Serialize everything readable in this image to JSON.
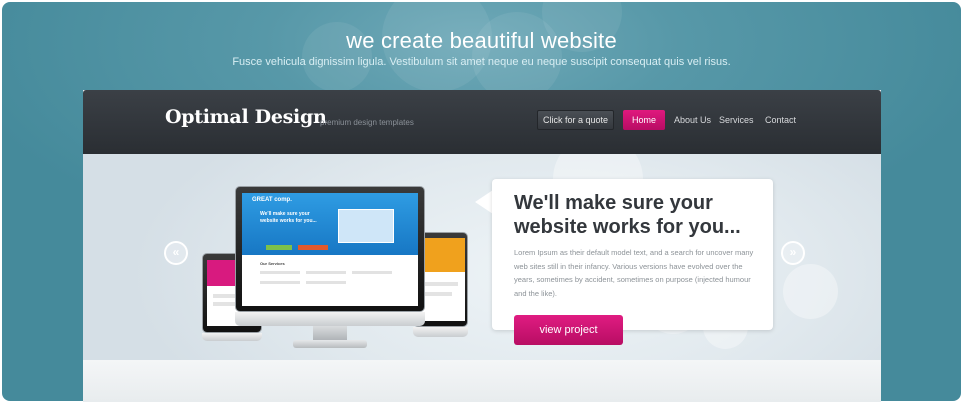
{
  "hero": {
    "headline": "we create beautiful website",
    "subline": "Fusce vehicula dignissim ligula. Vestibulum sit amet neque eu neque suscipit consequat quis vel risus."
  },
  "site": {
    "logo": "Optimal Design",
    "tagline": "premium design templates",
    "quote_button": "Click for a quote",
    "nav": [
      "Home",
      "About Us",
      "Services",
      "Contact"
    ],
    "active_nav": "Home"
  },
  "slide": {
    "title": "We'll make sure your website works for you...",
    "body": "Lorem Ipsum as their default model text, and a search for uncover many web sites still in their infancy. Various versions have evolved over the years, sometimes by accident, sometimes on purpose (injected humour and the like).",
    "button": "view project",
    "prev_icon": "double-chevron-left-icon",
    "next_icon": "double-chevron-right-icon"
  },
  "screen_mockup": {
    "brand": "GREAT comp.",
    "headline": "We'll make sure your website works for you...",
    "section": "Our Services"
  },
  "colors": {
    "accent": "#d4127a",
    "teal_background": "#4f93a4",
    "topbar": "#2f3338"
  }
}
